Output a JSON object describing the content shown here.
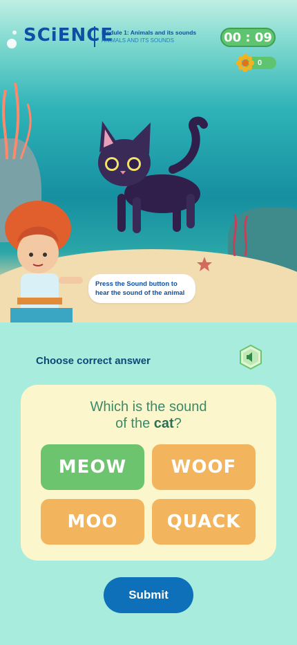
{
  "header": {
    "logo": "SCiENCE",
    "module_title": "Module 1: Animals and its sounds",
    "module_subtitle": "ANIMALS AND ITS SOUNDS",
    "timer": "00 : 09",
    "score": "0"
  },
  "scene": {
    "hint_line1": "Press the Sound button to",
    "hint_line2": "hear the sound of the animal"
  },
  "quiz": {
    "prompt": "Choose correct answer",
    "question_line1": "Which is the sound",
    "question_prefix": "of the ",
    "question_animal": "cat",
    "question_suffix": "?",
    "options": [
      "MEOW",
      "WOOF",
      "MOO",
      "QUACK"
    ],
    "selected_index": 0,
    "submit_label": "Submit"
  },
  "colors": {
    "brand_blue": "#0d4fa3",
    "option_default": "#f2b45d",
    "option_selected": "#6cc46e",
    "submit": "#0e70b8",
    "panel": "#a8ecdd",
    "card": "#fbf6cb"
  }
}
